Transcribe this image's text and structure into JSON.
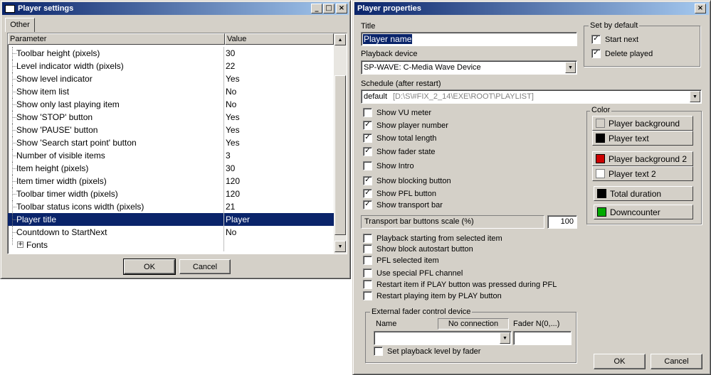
{
  "settings": {
    "title": "Player settings",
    "tab": "Other",
    "col_param": "Parameter",
    "col_value": "Value",
    "rows": [
      {
        "p": "Toolbar height (pixels)",
        "v": "30"
      },
      {
        "p": "Level indicator width (pixels)",
        "v": "22"
      },
      {
        "p": "Show level indicator",
        "v": "Yes"
      },
      {
        "p": "Show item list",
        "v": "No"
      },
      {
        "p": "Show only last playing item",
        "v": "No"
      },
      {
        "p": "Show 'STOP' button",
        "v": "Yes"
      },
      {
        "p": "Show 'PAUSE' button",
        "v": "Yes"
      },
      {
        "p": "Show 'Search start point' button",
        "v": "Yes"
      },
      {
        "p": "Number of visible items",
        "v": "3"
      },
      {
        "p": "Item height (pixels)",
        "v": "30"
      },
      {
        "p": "Item timer width (pixels)",
        "v": "120"
      },
      {
        "p": "Toolbar timer width (pixels)",
        "v": "120"
      },
      {
        "p": "Toolbar status icons width (pixels)",
        "v": "21"
      },
      {
        "p": "Player title",
        "v": "Player"
      },
      {
        "p": "Countdown to StartNext",
        "v": "No"
      },
      {
        "p": "Fonts",
        "v": ""
      }
    ],
    "ok": "OK",
    "cancel": "Cancel"
  },
  "props": {
    "title": "Player properties",
    "title_label": "Title",
    "title_value": "Player name",
    "device_label": "Playback device",
    "device_value": "SP-WAVE: C-Media Wave Device",
    "schedule_label": "Schedule (after restart)",
    "schedule_name": "default",
    "schedule_path": "[D:\\S\\#FIX_2_14\\EXE\\ROOT\\PLAYLIST]",
    "set_default_label": "Set by default",
    "start_next": "Start next",
    "delete_played": "Delete played",
    "show_checks": [
      {
        "label": "Show VU meter",
        "checked": false
      },
      {
        "label": "Show player number",
        "checked": true
      },
      {
        "label": "Show total length",
        "checked": true
      },
      {
        "label": "Show fader state",
        "checked": true
      },
      {
        "label": "Show Intro",
        "checked": false
      },
      {
        "label": "Show blocking button",
        "checked": true
      },
      {
        "label": "Show PFL button",
        "checked": true
      },
      {
        "label": "Show transport bar",
        "checked": true
      }
    ],
    "transport_label": "Transport bar buttons scale (%)",
    "transport_value": "100",
    "option_checks": [
      {
        "label": "Playback starting from selected item",
        "checked": false
      },
      {
        "label": "Show block autostart button",
        "checked": false
      },
      {
        "label": "PFL selected item",
        "checked": false
      },
      {
        "label": "Use special PFL channel",
        "checked": false
      },
      {
        "label": "Restart item if PLAY button was pressed during PFL",
        "checked": false
      },
      {
        "label": "Restart playing item by PLAY button",
        "checked": false
      }
    ],
    "color_label": "Color",
    "colors": [
      {
        "label": "Player background",
        "color": "#d4d0c8"
      },
      {
        "label": "Player text",
        "color": "#000000"
      },
      {
        "label": "Player background 2",
        "color": "#cc0000"
      },
      {
        "label": "Player text 2",
        "color": "#ffffff"
      },
      {
        "label": "Total duration",
        "color": "#000000"
      },
      {
        "label": "Downcounter",
        "color": "#00aa00"
      }
    ],
    "ext_label": "External fader control device",
    "name_label": "Name",
    "no_connection": "No connection",
    "fader_label": "Fader N(0,...)",
    "set_level": "Set playback level by fader",
    "ok": "OK",
    "cancel": "Cancel"
  },
  "check_mark": "✓"
}
